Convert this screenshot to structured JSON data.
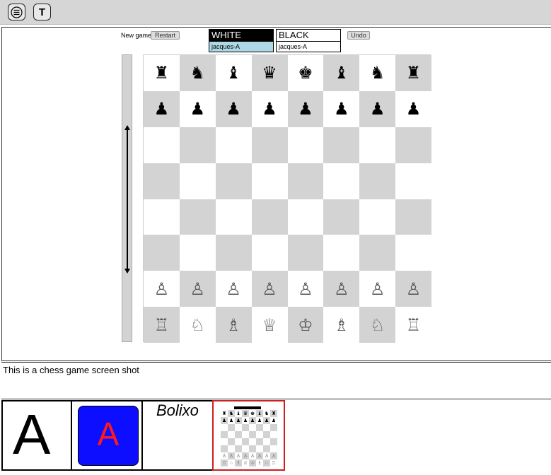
{
  "toolbar": {
    "menu_icon": "hamburger-menu-icon",
    "t_label": "T"
  },
  "controls": {
    "new_game_label": "New game",
    "restart_label": "Restart",
    "undo_label": "Undo"
  },
  "players": {
    "white": {
      "label": "WHITE",
      "user": "jacques-A"
    },
    "black": {
      "label": "BLACK",
      "user": "jacques-A"
    }
  },
  "board": {
    "rows": [
      [
        "♜",
        "♞",
        "♝",
        "♛",
        "♚",
        "♝",
        "♞",
        "♜"
      ],
      [
        "♟",
        "♟",
        "♟",
        "♟",
        "♟",
        "♟",
        "♟",
        "♟"
      ],
      [
        "",
        "",
        "",
        "",
        "",
        "",
        "",
        ""
      ],
      [
        "",
        "",
        "",
        "",
        "",
        "",
        "",
        ""
      ],
      [
        "",
        "",
        "",
        "",
        "",
        "",
        "",
        ""
      ],
      [
        "",
        "",
        "",
        "",
        "",
        "",
        "",
        ""
      ],
      [
        "♙",
        "♙",
        "♙",
        "♙",
        "♙",
        "♙",
        "♙",
        "♙"
      ],
      [
        "♖",
        "♘",
        "♗",
        "♕",
        "♔",
        "♗",
        "♘",
        "♖"
      ]
    ]
  },
  "caption": "This is a chess game screen shot",
  "thumbnails": {
    "a_letter": "A",
    "blue_letter": "A",
    "bolixo_label": "Bolixo"
  },
  "colors": {
    "toolbar_bg": "#d6d6d6",
    "dark_square": "#d3d3d3",
    "light_square": "#ffffff",
    "white_user_bg": "#aed8e6",
    "thumb_blue": "#0d0dff",
    "thumb_red_letter": "#ff1a1a",
    "thumb_selected_border": "#cc1f1f"
  }
}
